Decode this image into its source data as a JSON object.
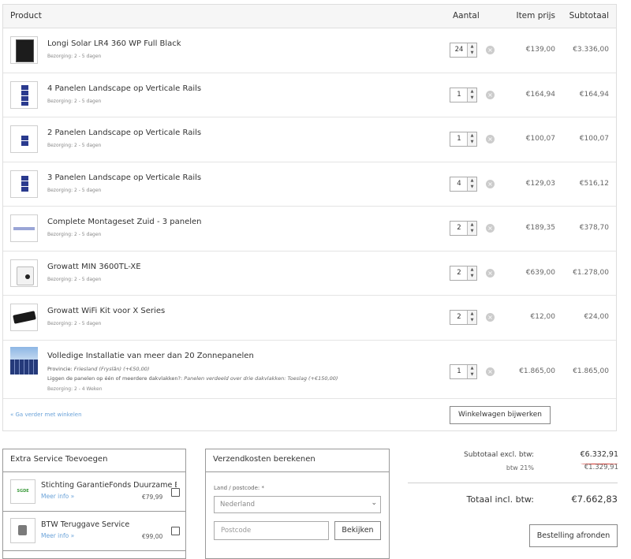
{
  "header": {
    "product": "Product",
    "quantity": "Aantal",
    "item_price": "Item prijs",
    "subtotal": "Subtotaal"
  },
  "items": [
    {
      "name": "Longi Solar LR4 360 WP Full Black",
      "delivery": "Bezorging: 2 - 5 dagen",
      "qty": "24",
      "price": "€139,00",
      "subtotal": "€3.336,00"
    },
    {
      "name": "4 Panelen Landscape op Verticale Rails",
      "delivery": "Bezorging: 2 - 5 dagen",
      "qty": "1",
      "price": "€164,94",
      "subtotal": "€164,94"
    },
    {
      "name": "2 Panelen Landscape op Verticale Rails",
      "delivery": "Bezorging: 2 - 5 dagen",
      "qty": "1",
      "price": "€100,07",
      "subtotal": "€100,07"
    },
    {
      "name": "3 Panelen Landscape op Verticale Rails",
      "delivery": "Bezorging: 2 - 5 dagen",
      "qty": "4",
      "price": "€129,03",
      "subtotal": "€516,12"
    },
    {
      "name": "Complete Montageset Zuid - 3 panelen",
      "delivery": "Bezorging: 2 - 5 dagen",
      "qty": "2",
      "price": "€189,35",
      "subtotal": "€378,70"
    },
    {
      "name": "Growatt MIN 3600TL-XE",
      "delivery": "Bezorging: 2 - 5 dagen",
      "qty": "2",
      "price": "€639,00",
      "subtotal": "€1.278,00"
    },
    {
      "name": "Growatt WiFi Kit voor X Series",
      "delivery": "Bezorging: 2 - 5 dagen",
      "qty": "2",
      "price": "€12,00",
      "subtotal": "€24,00"
    },
    {
      "name": "Volledige Installatie van meer dan 20 Zonnepanelen",
      "opt1_label": "Provincie: ",
      "opt1_value": "Friesland (Fryslân) (+€50,00)",
      "opt2_label": "Liggen de panelen op één of meerdere dakvlakken?: ",
      "opt2_value": "Panelen verdeeld over drie dakvlakken: Toeslag (+€150,00)",
      "delivery": "Bezorging: 2 - 4 Weken",
      "qty": "1",
      "price": "€1.865,00",
      "subtotal": "€1.865,00"
    }
  ],
  "continue_link": "« Ga verder met winkelen",
  "update_button": "Winkelwagen bijwerken",
  "extra_service": {
    "title": "Extra Service Toevoegen",
    "items": [
      {
        "name": "Stichting GarantieFonds Duurzame Energie",
        "more": "Meer info »",
        "price": "€79,99",
        "logo": "SGDE"
      },
      {
        "name": "BTW Teruggave Service",
        "more": "Meer info »",
        "price": "€99,00"
      }
    ]
  },
  "shipping": {
    "title": "Verzendkosten berekenen",
    "country_label": "Land / postcode: *",
    "country_value": "Nederland",
    "postcode_placeholder": "Postcode",
    "check_button": "Bekijken"
  },
  "totals": {
    "subtotal_label": "Subtotaal excl. btw:",
    "subtotal_value": "€6.332,91",
    "vat_label": "btw 21%",
    "vat_value": "€1.329,91",
    "total_label": "Totaal incl. btw:",
    "total_value": "€7.662,83",
    "checkout_button": "Bestelling afronden"
  },
  "colors": {
    "link": "#6aa2d8",
    "border": "#dedede",
    "underline": "#d0342c"
  }
}
